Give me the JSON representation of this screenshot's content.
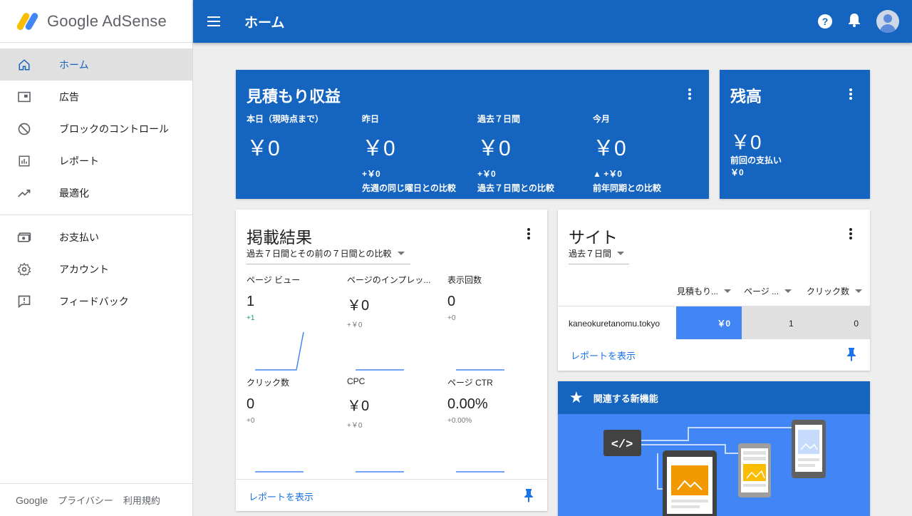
{
  "app": {
    "name": "Google AdSense"
  },
  "header": {
    "title": "ホーム"
  },
  "sidebar": {
    "items": [
      {
        "label": "ホーム",
        "icon": "home-icon",
        "active": true
      },
      {
        "label": "広告",
        "icon": "ads-icon"
      },
      {
        "label": "ブロックのコントロール",
        "icon": "block-icon"
      },
      {
        "label": "レポート",
        "icon": "report-icon"
      },
      {
        "label": "最適化",
        "icon": "trending-icon"
      }
    ],
    "items2": [
      {
        "label": "お支払い",
        "icon": "payment-icon"
      },
      {
        "label": "アカウント",
        "icon": "settings-icon"
      },
      {
        "label": "フィードバック",
        "icon": "feedback-icon"
      }
    ],
    "footer": {
      "google": "Google",
      "privacy": "プライバシー",
      "terms": "利用規約"
    }
  },
  "earnings": {
    "title": "見積もり収益",
    "columns": [
      {
        "label": "本日（現時点まで）",
        "value": "￥0",
        "delta": "",
        "compare": ""
      },
      {
        "label": "昨日",
        "value": "￥0",
        "delta": "+￥0",
        "compare": "先週の同じ曜日との比較"
      },
      {
        "label": "過去７日間",
        "value": "￥0",
        "delta": "+￥0",
        "compare": "過去７日間との比較"
      },
      {
        "label": "今月",
        "value": "￥0",
        "delta": "▲ +￥0",
        "compare": "前年同期との比較"
      }
    ]
  },
  "balance": {
    "title": "残高",
    "value": "￥0",
    "last_payment_label": "前回の支払い",
    "last_payment_value": "￥0"
  },
  "performance": {
    "title": "掲載結果",
    "range": "過去７日間とその前の７日間との比較",
    "metrics": [
      {
        "name": "ページ ビュー",
        "value": "1",
        "delta": "+1"
      },
      {
        "name": "ページのインプレッ...",
        "value": "￥0",
        "delta": "+￥0"
      },
      {
        "name": "表示回数",
        "value": "0",
        "delta": "+0"
      },
      {
        "name": "クリック数",
        "value": "0",
        "delta": "+0"
      },
      {
        "name": "CPC",
        "value": "￥0",
        "delta": "+￥0"
      },
      {
        "name": "ページ CTR",
        "value": "0.00%",
        "delta": "+0.00%"
      }
    ],
    "link": "レポートを表示"
  },
  "sites": {
    "title": "サイト",
    "range": "過去７日間",
    "columns": [
      "見積もり...",
      "ページ ...",
      "クリック数"
    ],
    "rows": [
      {
        "domain": "kaneokuretanomu.tokyo",
        "earnings": "￥0",
        "pages": "1",
        "clicks": "0"
      }
    ],
    "link": "レポートを表示"
  },
  "features": {
    "title": "関連する新機能",
    "code_label": "</>"
  },
  "colors": {
    "primary": "#1565c0",
    "accent": "#4285f4",
    "link": "#1a73e8"
  }
}
